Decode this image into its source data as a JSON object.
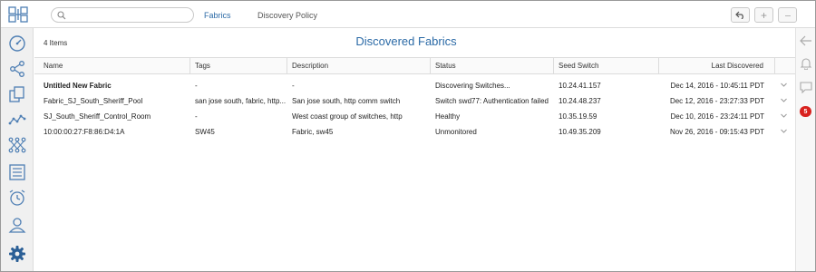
{
  "topbar": {
    "search_placeholder": "",
    "tabs": [
      {
        "label": "Fabrics",
        "active": true
      },
      {
        "label": "Discovery Policy",
        "active": false
      }
    ],
    "buttons": [
      {
        "icon": "undo-icon",
        "glyph": "↶"
      },
      {
        "icon": "plus-icon",
        "glyph": "+"
      },
      {
        "icon": "more-icon",
        "glyph": "···"
      }
    ]
  },
  "sidebar": {
    "items": [
      {
        "icon": "dashboard-icon"
      },
      {
        "icon": "share-icon"
      },
      {
        "icon": "copy-icon"
      },
      {
        "icon": "analytics-icon"
      },
      {
        "icon": "topology-icon"
      },
      {
        "icon": "list-icon"
      },
      {
        "icon": "alarm-clock-icon"
      },
      {
        "icon": "user-icon"
      },
      {
        "icon": "gear-icon"
      }
    ]
  },
  "rightrail": {
    "badge_count": "5"
  },
  "main": {
    "item_count": "4 Items",
    "title": "Discovered Fabrics",
    "columns": [
      "Name",
      "Tags",
      "Description",
      "Status",
      "Seed Switch",
      "Last Discovered"
    ],
    "rows": [
      {
        "name": "Untitled New Fabric",
        "bold": true,
        "tags": "-",
        "description": "-",
        "status": "Discovering Switches...",
        "seed": "10.24.41.157",
        "last": "Dec 14, 2016 - 10:45:11 PDT"
      },
      {
        "name": "Fabric_SJ_South_Sheriff_Pool",
        "bold": false,
        "tags": "san jose south, fabric, http...",
        "description": "San jose south, http comm switch",
        "status": "Switch swd77: Authentication failed",
        "seed": "10.24.48.237",
        "last": "Dec 12, 2016 - 23:27:33 PDT"
      },
      {
        "name": "SJ_South_Sheriff_Control_Room",
        "bold": false,
        "tags": "-",
        "description": "West coast group of switches, http",
        "status": "Healthy",
        "seed": "10.35.19.59",
        "last": "Dec 10, 2016 - 23:24:11 PDT"
      },
      {
        "name": "10:00:00:27:F8:86:D4:1A",
        "bold": false,
        "tags": "SW45",
        "description": "Fabric, sw45",
        "status": "Unmonitored",
        "seed": "10.49.35.209",
        "last": "Nov 26, 2016 - 09:15:43 PDT"
      }
    ]
  },
  "colors": {
    "accent": "#2b6aa6",
    "badge": "#d8221f",
    "icon": "#4f7fb4",
    "gear": "#2b5f96"
  }
}
